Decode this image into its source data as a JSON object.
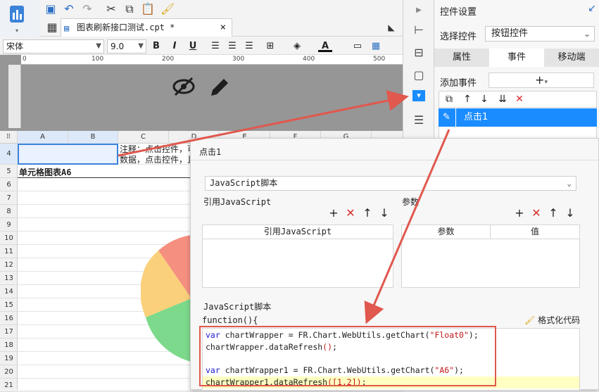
{
  "toolbar": {
    "tab_title": "图表刷新接口测试.cpt *",
    "tab_close": "×"
  },
  "font_bar": {
    "font_family": "宋体",
    "font_size": "9.0",
    "bold": "B",
    "italic": "I",
    "underline": "U",
    "font_color_letter": "A"
  },
  "ruler": {
    "ticks": [
      "0",
      "100",
      "200",
      "300",
      "400",
      "500"
    ]
  },
  "sheet": {
    "columns": [
      "A",
      "B",
      "C",
      "D",
      "E",
      "F",
      "G"
    ],
    "rows": [
      "4",
      "5",
      "6",
      "7",
      "8",
      "9",
      "10",
      "11",
      "12",
      "13",
      "14",
      "15",
      "16",
      "17",
      "18",
      "19",
      "20",
      "21"
    ],
    "cell_C4_line1": "注释：点击控件，可",
    "cell_C4_line2": "数据，点击控件，且",
    "cell_A5": "单元格图表A6"
  },
  "right_panel": {
    "title": "控件设置",
    "select_label": "选择控件",
    "select_value": "按钮控件",
    "tabs": [
      "属性",
      "事件",
      "移动端"
    ],
    "active_tab": "事件",
    "add_event_label": "添加事件",
    "add_event_button": "+",
    "events": [
      "点击1"
    ]
  },
  "dialog": {
    "title": "点击1",
    "type_select": "JavaScript脚本",
    "ref_js_label": "引用JavaScript",
    "ref_js_col": "引用JavaScript",
    "params_label": "参数",
    "params_cols": [
      "参数",
      "值"
    ],
    "script_label": "JavaScript脚本",
    "function_header": "function(){",
    "format_button": "格式化代码",
    "code_lines": [
      {
        "kw": "var",
        "rest": " chartWrapper = FR.Chart.WebUtils.getChart(",
        "str": "\"Float0\"",
        "tail": ");"
      },
      {
        "kw": "",
        "rest": "chartWrapper.dataRefresh",
        "str": "()",
        "tail": ";"
      },
      {
        "kw": "",
        "rest": "",
        "str": "",
        "tail": ""
      },
      {
        "kw": "var",
        "rest": " chartWrapper1 = FR.Chart.WebUtils.getChart(",
        "str": "\"A6\"",
        "tail": ");"
      },
      {
        "kw": "",
        "rest": "chartWrapper1.dataRefresh",
        "str": "([1,2])",
        "tail": ";"
      }
    ]
  },
  "colors": {
    "accent_blue": "#1a8cff",
    "highlight_red": "#e0584e",
    "delete_red": "#d9302c"
  }
}
